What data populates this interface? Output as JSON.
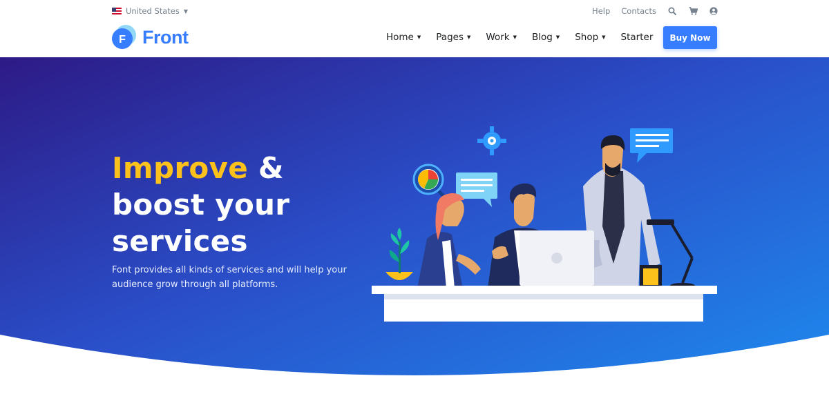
{
  "topbar": {
    "locale": "United States",
    "links": [
      "Help",
      "Contacts"
    ],
    "icons": [
      "search-icon",
      "cart-icon",
      "user-icon"
    ]
  },
  "header": {
    "logo_text": "Front",
    "logo_letter": "F",
    "nav": [
      {
        "label": "Home",
        "dropdown": true
      },
      {
        "label": "Pages",
        "dropdown": true
      },
      {
        "label": "Work",
        "dropdown": true
      },
      {
        "label": "Blog",
        "dropdown": true
      },
      {
        "label": "Shop",
        "dropdown": true
      },
      {
        "label": "Starter",
        "dropdown": false
      }
    ],
    "cta": "Buy Now"
  },
  "hero": {
    "headline_accent": "Improve",
    "headline_rest_1": " &",
    "headline_line_2": "boost your",
    "headline_line_3": "services",
    "subtext": "Font provides all kinds of services and will help your audience grow through all platforms."
  },
  "colors": {
    "brand": "#377dff",
    "accent": "#fdc11c",
    "hero_start": "#2d1a86",
    "hero_end": "#1d8ff2"
  }
}
